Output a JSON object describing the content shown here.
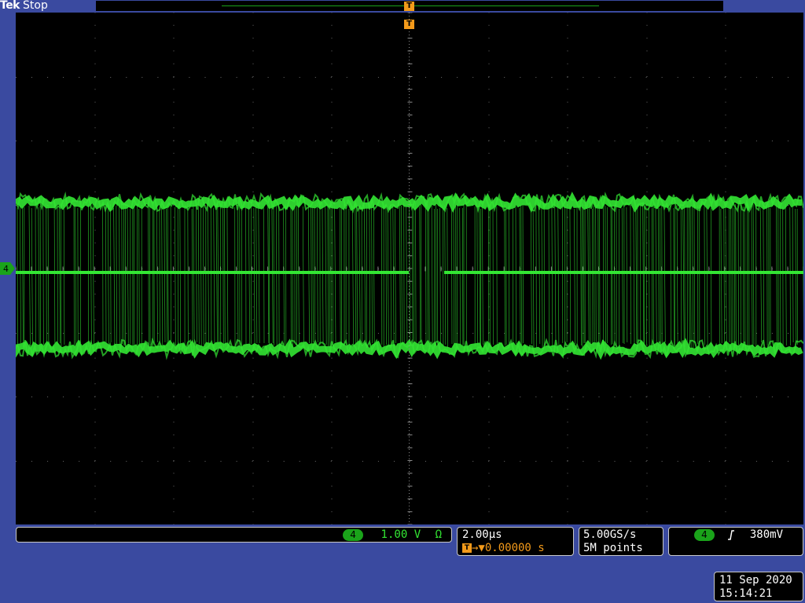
{
  "header": {
    "brand": "Tek",
    "acquisition_state": "Stop"
  },
  "trigger": {
    "position_marker": "T",
    "position_seconds": "0.00000 s"
  },
  "channel": {
    "number": "4",
    "scale": "1.00 V",
    "termination": "Ω",
    "color": "#33e633"
  },
  "timebase": {
    "scale": "2.00µs",
    "position_marker": "T",
    "position_arrow": "→▼",
    "position_value": "0.00000 s"
  },
  "acquisition": {
    "sample_rate": "5.00GS/s",
    "record_length": "5M points"
  },
  "trigger_readout": {
    "source": "4",
    "slope_icon": "rising-edge-icon",
    "level": "380mV"
  },
  "datetime": {
    "date": "11 Sep  2020",
    "time": "15:14:21"
  },
  "colors": {
    "background": "#3a4aa0",
    "screen": "#000000",
    "trace": "#33e633",
    "trigger_accent": "#f39a1a"
  }
}
